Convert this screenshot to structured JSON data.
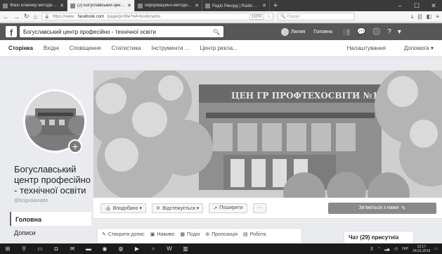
{
  "browser": {
    "tabs": [
      {
        "label": "Фанс клайнер методиста • Бо…",
        "active": false
      },
      {
        "label": "(2) Богуславський центр пр…",
        "active": true
      },
      {
        "label": "Інформаційно-методичний_кл…",
        "active": false
      },
      {
        "label": "Радіо Рекорд | Radio Rec… ◀)",
        "active": false
      }
    ],
    "new_tab": "+",
    "url_host": "facebook.com",
    "url_prefix": "https://www.",
    "url_rest": "/page/profile?ref=bookmarks",
    "zoom": "110%",
    "search_placeholder": "Пошук"
  },
  "facebook": {
    "search_value": "Богуславський центр професійно - технічної освіти",
    "user_name": "Лилия",
    "home_label": "Головна"
  },
  "subnav": {
    "links": [
      "Сторінка",
      "Вхідні",
      "Сповіщення",
      "Статистика",
      "Інструменти ...",
      "Центр рекла..."
    ],
    "right_links": [
      "Налаштування",
      "Допомога ▾"
    ]
  },
  "page": {
    "name": "Богуславський центр професійно - технічної освіти",
    "handle": "@boguslavvpto",
    "side_home": "Головна",
    "side_posts": "Дописи",
    "cover_sign": "ЦЕН ГР  ПРОФТЕХОСВІТИ №1"
  },
  "actions": {
    "liked": "Вподобано ▾",
    "follow": "Відстежується ▾",
    "share": "Поширити",
    "more": "···",
    "cta": "Зв'яжіться з нами"
  },
  "composer": {
    "items": [
      "Створити допис",
      "Наживо",
      "Подія",
      "Пропозиція",
      "Робота"
    ]
  },
  "chat": {
    "label": "Чат (29) присутніх"
  },
  "taskbar": {
    "time": "13:17",
    "date": "24.01.2019",
    "lang": "УКР"
  }
}
